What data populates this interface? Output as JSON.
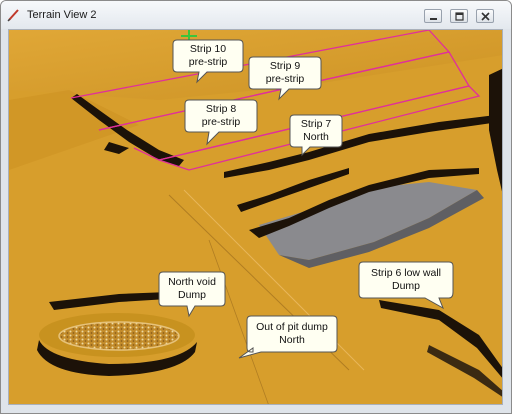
{
  "window": {
    "title": "Terrain View 2",
    "icon": "pencil-icon",
    "controls": [
      "minimize-icon",
      "maximize-icon",
      "close-icon"
    ]
  },
  "colors": {
    "terrain": "#d79e2c",
    "shadow": "#1c1208",
    "pit_floor": "#8a8a8e",
    "strip_outline": "#e0309a",
    "callout_fill": "#fffff2"
  },
  "callouts": [
    {
      "id": "strip10",
      "line1": "Strip 10",
      "line2": "pre-strip"
    },
    {
      "id": "strip9",
      "line1": "Strip 9",
      "line2": "pre-strip"
    },
    {
      "id": "strip8",
      "line1": "Strip 8",
      "line2": "pre-strip"
    },
    {
      "id": "strip7",
      "line1": "Strip 7",
      "line2": "North"
    },
    {
      "id": "strip6",
      "line1": "Strip 6 low wall",
      "line2": "Dump"
    },
    {
      "id": "northvoid",
      "line1": "North void",
      "line2": "Dump"
    },
    {
      "id": "outofpit",
      "line1": "Out of pit dump",
      "line2": "North"
    }
  ]
}
